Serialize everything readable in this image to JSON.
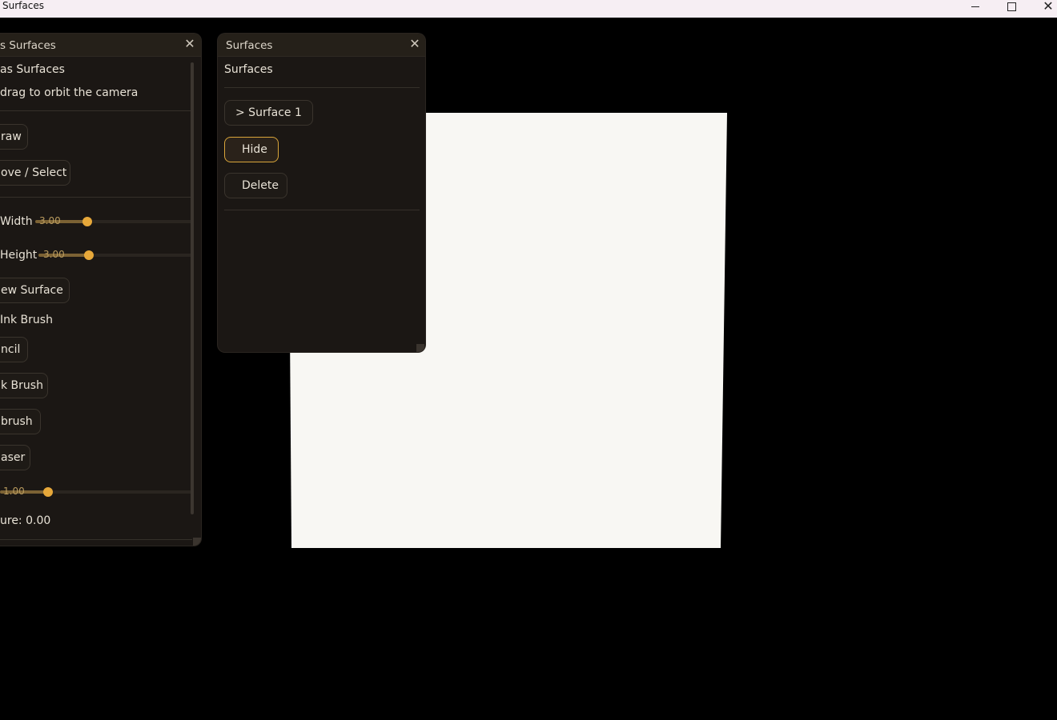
{
  "window": {
    "title": "Surfaces"
  },
  "left_panel": {
    "title": "s Surfaces",
    "heading": "as Surfaces",
    "hint": "drag to orbit the camera",
    "draw_button": "raw",
    "move_select_button": "ove / Select",
    "width_label": "Width",
    "width_value": "3.00",
    "width_fraction": 0.33,
    "height_label": "Height",
    "height_value": "3.00",
    "height_fraction": 0.33,
    "new_surface_button": "ew Surface",
    "current_brush_label": " Ink Brush",
    "pencil_button": "ncil",
    "ink_brush_button": "k Brush",
    "airbrush_button": "brush",
    "eraser_button": "aser",
    "size_value": "1.00",
    "size_fraction": 0.25,
    "pressure_label": "ure: 0.00"
  },
  "right_panel": {
    "title": "Surfaces",
    "heading": "Surfaces",
    "surface_item": "> Surface 1",
    "hide_button": "Hide",
    "delete_button": "Delete"
  },
  "colors": {
    "canvas_background": "#000000",
    "surface": "#f8f7f3",
    "accent": "#e7a83a"
  }
}
